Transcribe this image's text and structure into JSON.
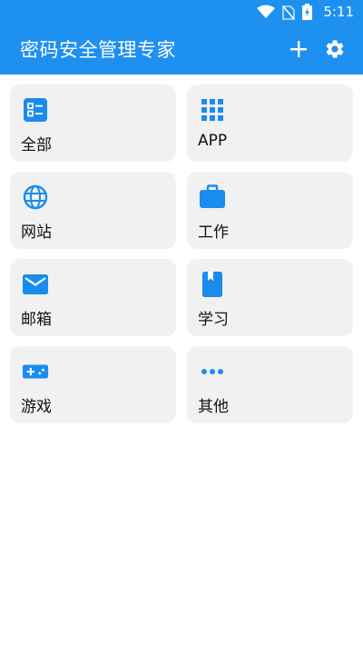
{
  "status_bar": {
    "time": "5:11",
    "icons": [
      "wifi-icon",
      "no-sim-icon",
      "battery-charging-icon"
    ]
  },
  "toolbar": {
    "title": "密码安全管理专家",
    "add_icon": "plus-icon",
    "settings_icon": "gear-icon"
  },
  "categories": [
    {
      "label": "全部",
      "icon": "list-icon"
    },
    {
      "label": "APP",
      "icon": "apps-grid-icon"
    },
    {
      "label": "网站",
      "icon": "globe-icon"
    },
    {
      "label": "工作",
      "icon": "briefcase-icon"
    },
    {
      "label": "邮箱",
      "icon": "mail-icon"
    },
    {
      "label": "学习",
      "icon": "book-icon"
    },
    {
      "label": "游戏",
      "icon": "gamepad-icon"
    },
    {
      "label": "其他",
      "icon": "more-dots-icon"
    }
  ],
  "colors": {
    "primary": "#1e90f0",
    "icon": "#1a8cf0",
    "card_bg": "#f1f1f1"
  }
}
